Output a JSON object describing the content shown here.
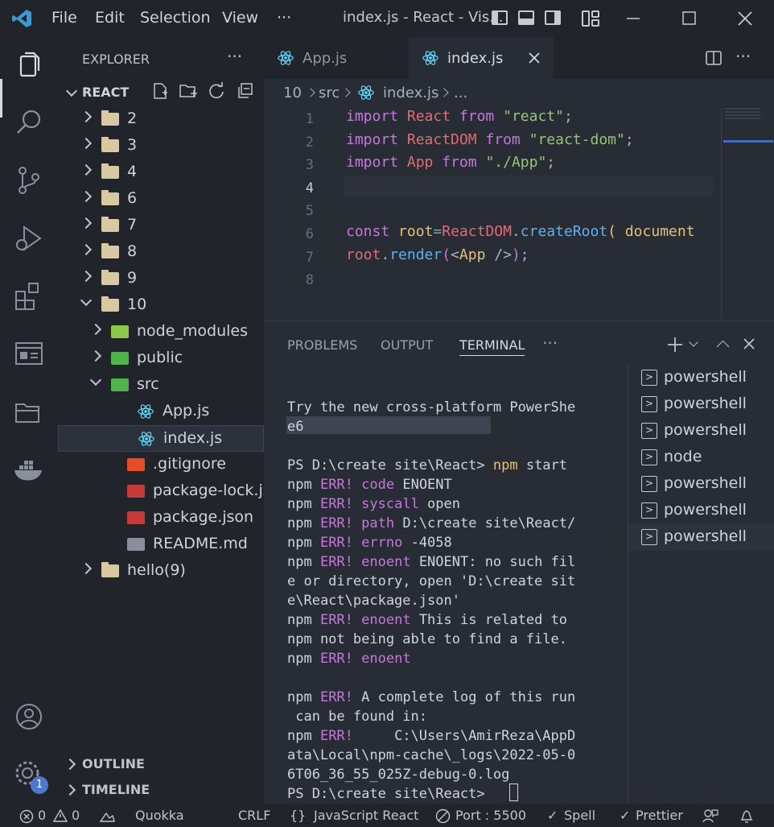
{
  "titlebar": {
    "menu": [
      "File",
      "Edit",
      "Selection",
      "View",
      "···"
    ],
    "window_title": "index.js - React - Vis..."
  },
  "sidebar": {
    "title": "EXPLORER",
    "more": "···",
    "root": "REACT",
    "tree": [
      {
        "label": "2",
        "kind": "folder",
        "state": "collapsed",
        "indent": 0
      },
      {
        "label": "3",
        "kind": "folder",
        "state": "collapsed",
        "indent": 0
      },
      {
        "label": "4",
        "kind": "folder",
        "state": "collapsed",
        "indent": 0
      },
      {
        "label": "6",
        "kind": "folder",
        "state": "collapsed",
        "indent": 0
      },
      {
        "label": "7",
        "kind": "folder",
        "state": "collapsed",
        "indent": 0
      },
      {
        "label": "8",
        "kind": "folder",
        "state": "collapsed",
        "indent": 0
      },
      {
        "label": "9",
        "kind": "folder",
        "state": "collapsed",
        "indent": 0
      },
      {
        "label": "10",
        "kind": "folder",
        "state": "expanded",
        "indent": 0
      },
      {
        "label": "node_modules",
        "kind": "node-folder",
        "state": "collapsed",
        "indent": 1
      },
      {
        "label": "public",
        "kind": "public-folder",
        "state": "collapsed",
        "indent": 1
      },
      {
        "label": "src",
        "kind": "src-folder",
        "state": "expanded",
        "indent": 1
      },
      {
        "label": "App.js",
        "kind": "react-file",
        "indent": 2
      },
      {
        "label": "index.js",
        "kind": "react-file",
        "indent": 2,
        "selected": true
      },
      {
        "label": ".gitignore",
        "kind": "git-file",
        "indent": 1
      },
      {
        "label": "package-lock.json",
        "kind": "npm-file",
        "indent": 1
      },
      {
        "label": "package.json",
        "kind": "npm-file",
        "indent": 1
      },
      {
        "label": "README.md",
        "kind": "md-file",
        "indent": 1
      },
      {
        "label": "hello(9)",
        "kind": "folder",
        "state": "collapsed",
        "indent": 0
      }
    ],
    "outline": "OUTLINE",
    "timeline": "TIMELINE"
  },
  "tabs": [
    {
      "label": "App.js",
      "active": false
    },
    {
      "label": "index.js",
      "active": true
    }
  ],
  "breadcrumb": {
    "p1": "10",
    "p2": "src",
    "p3": "index.js",
    "p4": "..."
  },
  "editor": {
    "lines": [
      {
        "n": "1",
        "tokens": [
          [
            "kw",
            "import"
          ],
          [
            "pl",
            " "
          ],
          [
            "vr",
            "React"
          ],
          [
            "pl",
            " "
          ],
          [
            "kw",
            "from"
          ],
          [
            "pl",
            " "
          ],
          [
            "st",
            "\"react\""
          ],
          [
            "txt",
            ";"
          ]
        ]
      },
      {
        "n": "2",
        "tokens": [
          [
            "kw",
            "import"
          ],
          [
            "pl",
            " "
          ],
          [
            "vr",
            "ReactDOM"
          ],
          [
            "pl",
            " "
          ],
          [
            "kw",
            "from"
          ],
          [
            "pl",
            " "
          ],
          [
            "st",
            "\"react-dom\""
          ],
          [
            "txt",
            ";"
          ]
        ]
      },
      {
        "n": "3",
        "tokens": [
          [
            "kw",
            "import"
          ],
          [
            "pl",
            " "
          ],
          [
            "vr",
            "App"
          ],
          [
            "pl",
            " "
          ],
          [
            "kw",
            "from"
          ],
          [
            "pl",
            " "
          ],
          [
            "st",
            "\"./App\""
          ],
          [
            "txt",
            ";"
          ]
        ]
      },
      {
        "n": "4",
        "tokens": []
      },
      {
        "n": "5",
        "tokens": []
      },
      {
        "n": "6",
        "tokens": [
          [
            "kw",
            "const"
          ],
          [
            "pl",
            " "
          ],
          [
            "yl",
            "root"
          ],
          [
            "pl",
            "="
          ],
          [
            "vr",
            "ReactDOM"
          ],
          [
            "txt",
            "."
          ],
          [
            "fn",
            "createRoot"
          ],
          [
            "yl",
            "("
          ],
          [
            "pl",
            " "
          ],
          [
            "yl",
            "document"
          ]
        ]
      },
      {
        "n": "7",
        "tokens": [
          [
            "vr",
            "root"
          ],
          [
            "txt",
            "."
          ],
          [
            "fn",
            "render"
          ],
          [
            "kw",
            "("
          ],
          [
            "txt",
            "<"
          ],
          [
            "yl",
            "App"
          ],
          [
            "txt",
            " />"
          ],
          [
            "kw",
            ")"
          ],
          [
            "txt",
            ";"
          ]
        ]
      },
      {
        "n": "8",
        "tokens": []
      }
    ]
  },
  "panel": {
    "tabs": [
      "PROBLEMS",
      "OUTPUT",
      "TERMINAL",
      "···"
    ],
    "terminal_lines": [
      [
        [
          "txt",
          "Try the new cross-platform PowerShe"
        ]
      ],
      [
        [
          "txt",
          "e6"
        ]
      ],
      [
        [
          "txt",
          ""
        ]
      ],
      [
        [
          "txt",
          "PS D:\\create site\\React> "
        ],
        [
          "ye",
          "npm"
        ],
        [
          "txt",
          " start"
        ]
      ],
      [
        [
          "txt",
          "npm "
        ],
        [
          "err",
          "ERR!"
        ],
        [
          "txt",
          " "
        ],
        [
          "err",
          "code"
        ],
        [
          "txt",
          " ENOENT"
        ]
      ],
      [
        [
          "txt",
          "npm "
        ],
        [
          "err",
          "ERR!"
        ],
        [
          "txt",
          " "
        ],
        [
          "err",
          "syscall"
        ],
        [
          "txt",
          " open"
        ]
      ],
      [
        [
          "txt",
          "npm "
        ],
        [
          "err",
          "ERR!"
        ],
        [
          "txt",
          " "
        ],
        [
          "err",
          "path"
        ],
        [
          "txt",
          " D:\\create site\\React/"
        ]
      ],
      [
        [
          "txt",
          "npm "
        ],
        [
          "err",
          "ERR!"
        ],
        [
          "txt",
          " "
        ],
        [
          "err",
          "errno"
        ],
        [
          "txt",
          " -4058"
        ]
      ],
      [
        [
          "txt",
          "npm "
        ],
        [
          "err",
          "ERR!"
        ],
        [
          "txt",
          " "
        ],
        [
          "err",
          "enoent"
        ],
        [
          "txt",
          " ENOENT: no such fil"
        ]
      ],
      [
        [
          "txt",
          "e or directory, open 'D:\\create sit"
        ]
      ],
      [
        [
          "txt",
          "e\\React\\package.json'"
        ]
      ],
      [
        [
          "txt",
          "npm "
        ],
        [
          "err",
          "ERR!"
        ],
        [
          "txt",
          " "
        ],
        [
          "err",
          "enoent"
        ],
        [
          "txt",
          " This is related to"
        ]
      ],
      [
        [
          "txt",
          "npm not being able to find a file."
        ]
      ],
      [
        [
          "txt",
          "npm "
        ],
        [
          "err",
          "ERR!"
        ],
        [
          "txt",
          " "
        ],
        [
          "err",
          "enoent"
        ]
      ],
      [
        [
          "txt",
          ""
        ]
      ],
      [
        [
          "txt",
          "npm "
        ],
        [
          "err",
          "ERR!"
        ],
        [
          "txt",
          " A complete log of this run"
        ]
      ],
      [
        [
          "txt",
          " can be found in:"
        ]
      ],
      [
        [
          "txt",
          "npm "
        ],
        [
          "err",
          "ERR!"
        ],
        [
          "txt",
          "     C:\\Users\\AmirReza\\AppD"
        ]
      ],
      [
        [
          "txt",
          "ata\\Local\\npm-cache\\_logs\\2022-05-0"
        ]
      ],
      [
        [
          "txt",
          "6T06_36_55_025Z-debug-0.log"
        ]
      ],
      [
        [
          "txt",
          "PS D:\\create site\\React> "
        ]
      ]
    ],
    "terminals": [
      {
        "label": "powershell",
        "selected": false
      },
      {
        "label": "powershell",
        "selected": false
      },
      {
        "label": "powershell",
        "selected": false
      },
      {
        "label": "node",
        "selected": false
      },
      {
        "label": "powershell",
        "selected": false
      },
      {
        "label": "powershell",
        "selected": false
      },
      {
        "label": "powershell",
        "selected": true
      }
    ]
  },
  "accounts_badge": "1",
  "status": {
    "errors": "0",
    "warnings": "0",
    "quokka": "Quokka",
    "eol": "CRLF",
    "braces": "{}",
    "language": "JavaScript React",
    "port": "Port : 5500",
    "spell": "Spell",
    "prettier": "Prettier"
  },
  "colors": {
    "accent": "#4d78cc",
    "keyword": "#c678dd",
    "variable": "#e06c75",
    "string": "#98c379"
  }
}
